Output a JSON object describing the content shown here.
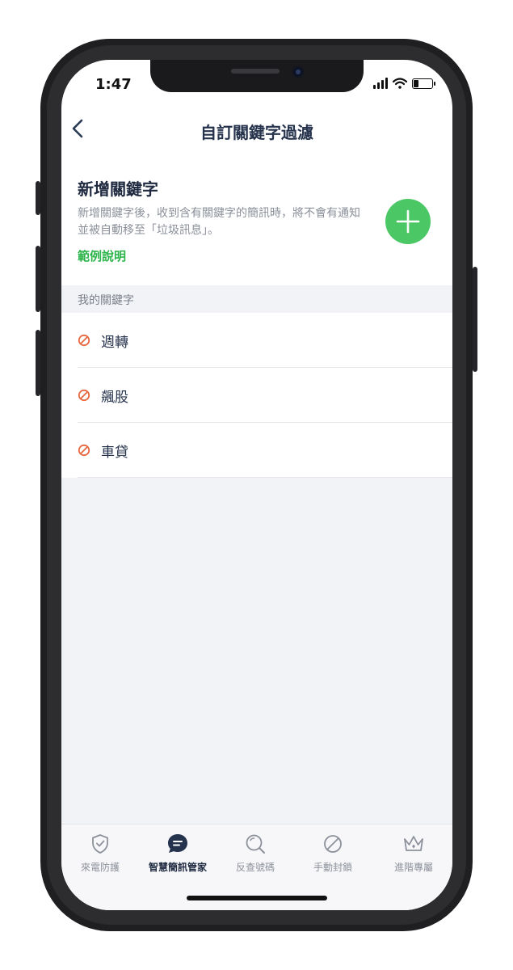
{
  "status_bar": {
    "time": "1:47"
  },
  "nav": {
    "back_glyph": "‹",
    "title": "自訂關鍵字過濾"
  },
  "add_section": {
    "title": "新增關鍵字",
    "description": "新增關鍵字後，收到含有關鍵字的簡訊時，將不會有通知並被自動移至「垃圾訊息」。",
    "example_link": "範例說明",
    "add_button_icon": "plus-icon"
  },
  "keywords_section": {
    "header": "我的關鍵字",
    "items": [
      {
        "label": "週轉",
        "icon": "block-icon"
      },
      {
        "label": "飆股",
        "icon": "block-icon"
      },
      {
        "label": "車貸",
        "icon": "block-icon"
      }
    ]
  },
  "tab_bar": {
    "tabs": [
      {
        "label": "來電防護",
        "icon": "shield-check-icon",
        "active": false
      },
      {
        "label": "智慧簡訊管家",
        "icon": "message-icon",
        "active": true
      },
      {
        "label": "反查號碼",
        "icon": "search-icon",
        "active": false
      },
      {
        "label": "手動封鎖",
        "icon": "block-icon",
        "active": false
      },
      {
        "label": "進階專屬",
        "icon": "crown-icon",
        "active": false
      }
    ]
  },
  "colors": {
    "accent_green": "#4cc765",
    "link_green": "#2cb44a",
    "block_icon": "#e8683f",
    "title_navy": "#26334d"
  }
}
